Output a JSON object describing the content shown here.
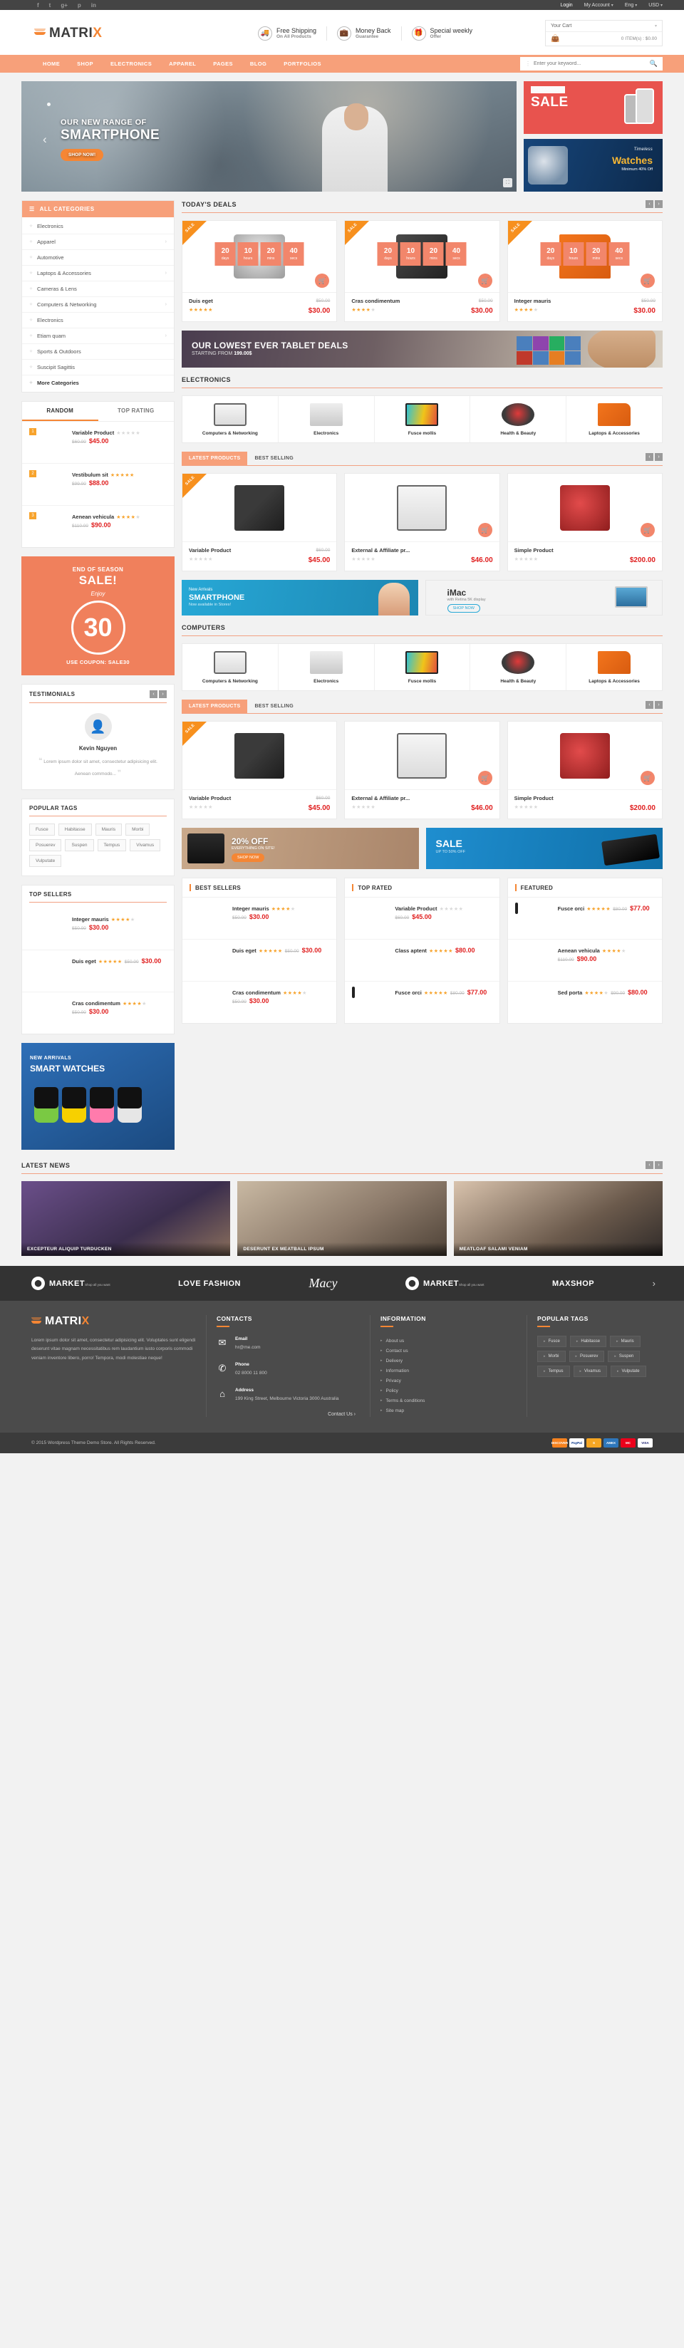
{
  "topbar": {
    "social": [
      "f",
      "t",
      "g+",
      "p",
      "in"
    ],
    "links": [
      "Login",
      "My Account",
      "Eng",
      "USD"
    ]
  },
  "header": {
    "logo": {
      "text_main": "MATRI",
      "text_accent": "X"
    },
    "features": [
      {
        "icon": "truck-icon",
        "title": "Free Shipping",
        "sub": "On All Products"
      },
      {
        "icon": "briefcase-icon",
        "title": "Money Back",
        "sub": "Guarantee"
      },
      {
        "icon": "gift-icon",
        "title": "Special weekly",
        "sub": "Offer"
      }
    ],
    "cart": {
      "label": "Your Cart",
      "summary": "0 ITEM(s) : $0.00"
    }
  },
  "nav": {
    "items": [
      "HOME",
      "SHOP",
      "ELECTRONICS",
      "APPAREL",
      "PAGES",
      "BLOG",
      "PORTFOLIOS"
    ],
    "search_placeholder": "Enter your keyword..."
  },
  "hero": {
    "line1": "OUR NEW RANGE OF",
    "line2": "SMARTPHONE",
    "button": "SHOP NOW!"
  },
  "promos": {
    "sale": {
      "tag": "CLEARANCE",
      "title": "SALE"
    },
    "watch": {
      "l1": "Timeless",
      "l2": "Watches",
      "l3": "Minimum 40% Off"
    }
  },
  "sidebar": {
    "categories_title": "ALL CATEGORIES",
    "categories": [
      {
        "label": "Electronics",
        "has_arrow": false
      },
      {
        "label": "Apparel",
        "has_arrow": true
      },
      {
        "label": "Automotive",
        "has_arrow": false
      },
      {
        "label": "Laptops & Accessories",
        "has_arrow": true
      },
      {
        "label": "Cameras & Lens",
        "has_arrow": false
      },
      {
        "label": "Computers & Networking",
        "has_arrow": true
      },
      {
        "label": "Electronics",
        "has_arrow": false
      },
      {
        "label": "Etiam quam",
        "has_arrow": true
      },
      {
        "label": "Sports & Outdoors",
        "has_arrow": false
      },
      {
        "label": "Suscipit Sagittis",
        "has_arrow": false
      },
      {
        "label": "More Categories",
        "has_arrow": false
      }
    ],
    "tabs": [
      "RANDOM",
      "TOP RATING"
    ],
    "random_products": [
      {
        "rank": "1",
        "name": "Variable Product",
        "stars": 0,
        "old": "$60.00",
        "new": "$45.00",
        "img": "pi-phone"
      },
      {
        "rank": "2",
        "name": "Vestibulum sit",
        "stars": 5,
        "old": "$99.00",
        "new": "$88.00",
        "img": "pi-micro"
      },
      {
        "rank": "3",
        "name": "Aenean vehicula",
        "stars": 4,
        "old": "$110.00",
        "new": "$90.00",
        "img": "pi-wash"
      }
    ],
    "season": {
      "l1": "END OF SEASON",
      "l2": "SALE!",
      "l3": "Enjoy",
      "number": "30",
      "l4": "USE COUPON: SALE30"
    },
    "testimonials_title": "TESTIMONIALS",
    "testimonial": {
      "name": "Kevin Nguyen",
      "text": "Lorem ipsum dolor sit amet, consectetur adipisicing elit. Aenean commodo..."
    },
    "tags_title": "POPULAR TAGS",
    "tags": [
      "Fusce",
      "Habitasse",
      "Mauris",
      "Morbi",
      "Posuerev",
      "Suspen",
      "Tempus",
      "Vivamus",
      "Vulputate"
    ],
    "top_sellers_title": "TOP SELLERS",
    "top_sellers": [
      {
        "name": "Integer mauris",
        "stars": 4,
        "old": "$50.00",
        "new": "$30.00",
        "img": "pi-laptop"
      },
      {
        "name": "Duis eget",
        "stars": 5,
        "old": "$50.00",
        "new": "$30.00",
        "img": "pi-watch"
      },
      {
        "name": "Cras condimentum",
        "stars": 4,
        "old": "$50.00",
        "new": "$30.00",
        "img": "pi-cam"
      }
    ],
    "watch_banner": {
      "l1": "NEW ARRIVALS",
      "l2": "SMART WATCHES"
    }
  },
  "deals": {
    "title": "TODAY'S DEALS",
    "ribbon": "SALE",
    "countdown": [
      {
        "value": "20",
        "unit": "days"
      },
      {
        "value": "10",
        "unit": "hours"
      },
      {
        "value": "20",
        "unit": "mins"
      },
      {
        "value": "40",
        "unit": "secs"
      }
    ],
    "items": [
      {
        "name": "Duis eget",
        "stars": 5,
        "old": "$50.00",
        "new": "$30.00",
        "img": "pi-watch"
      },
      {
        "name": "Cras condimentum",
        "stars": 4,
        "old": "$50.00",
        "new": "$30.00",
        "img": "pi-cam"
      },
      {
        "name": "Integer mauris",
        "stars": 4,
        "old": "$50.00",
        "new": "$30.00",
        "img": "pi-laptop"
      }
    ]
  },
  "tablet_banner": {
    "title": "OUR LOWEST EVER TABLET DEALS",
    "sub": "STARTING FROM ",
    "price": "199.00$"
  },
  "electronics": {
    "title": "ELECTRONICS",
    "categories": [
      {
        "label": "Computers & Networking",
        "img": "pi-ipad"
      },
      {
        "label": "Electronics",
        "img": "pi-wash"
      },
      {
        "label": "Fusce mollis",
        "img": "pi-tv"
      },
      {
        "label": "Health & Beauty",
        "img": "pi-head"
      },
      {
        "label": "Laptops & Accessories",
        "img": "pi-laptop"
      }
    ],
    "tabs": [
      "LATEST PRODUCTS",
      "BEST SELLING"
    ],
    "products": [
      {
        "name": "Variable Product",
        "stars": 0,
        "old": "$60.00",
        "new": "$45.00",
        "img": "pi-phone",
        "ribbon": "SALE"
      },
      {
        "name": "External & Affiliate pr...",
        "stars": 0,
        "old": "",
        "new": "$46.00",
        "img": "pi-ipad",
        "ribbon": ""
      },
      {
        "name": "Simple Product",
        "stars": 0,
        "old": "",
        "new": "$200.00",
        "img": "pi-redcam",
        "ribbon": ""
      }
    ]
  },
  "mid_banners": {
    "smartphone": {
      "l1": "New Arrivals",
      "l2": "SMARTPHONE",
      "l3": "Now available in Stores!"
    },
    "imac": {
      "l1": "iMac",
      "l2": "with Retina 5K display",
      "btn": "SHOP NOW"
    }
  },
  "computers": {
    "title": "COMPUTERS",
    "categories": [
      {
        "label": "Computers & Networking",
        "img": "pi-ipad"
      },
      {
        "label": "Electronics",
        "img": "pi-wash"
      },
      {
        "label": "Fusce mollis",
        "img": "pi-tv"
      },
      {
        "label": "Health & Beauty",
        "img": "pi-head"
      },
      {
        "label": "Laptops & Accessories",
        "img": "pi-laptop"
      }
    ],
    "tabs": [
      "LATEST PRODUCTS",
      "BEST SELLING"
    ],
    "products": [
      {
        "name": "Variable Product",
        "stars": 0,
        "old": "$60.00",
        "new": "$45.00",
        "img": "pi-phone",
        "ribbon": "SALE"
      },
      {
        "name": "External & Affiliate pr...",
        "stars": 0,
        "old": "",
        "new": "$46.00",
        "img": "pi-ipad",
        "ribbon": ""
      },
      {
        "name": "Simple Product",
        "stars": 0,
        "old": "",
        "new": "$200.00",
        "img": "pi-redcam",
        "ribbon": ""
      }
    ]
  },
  "bottom_banners": {
    "speaker": {
      "l1": "20% OFF",
      "l2": "EVERYTHING ON SITE!",
      "btn": "SHOP NOW"
    },
    "sale": {
      "l1": "SALE",
      "l2": "UP TO 50% OFF"
    }
  },
  "widgets": [
    {
      "title": "BEST SELLERS",
      "items": [
        {
          "name": "Integer mauris",
          "stars": 4,
          "old": "$50.00",
          "new": "$30.00",
          "img": "pi-laptop"
        },
        {
          "name": "Duis eget",
          "stars": 5,
          "old": "$50.00",
          "new": "$30.00",
          "img": "pi-watch"
        },
        {
          "name": "Cras condimentum",
          "stars": 4,
          "old": "$50.00",
          "new": "$30.00",
          "img": "pi-cam"
        }
      ]
    },
    {
      "title": "TOP RATED",
      "items": [
        {
          "name": "Variable Product",
          "stars": 0,
          "old": "$60.00",
          "new": "$45.00",
          "img": "pi-phone"
        },
        {
          "name": "Class aptent",
          "stars": 5,
          "old": "",
          "new": "$80.00",
          "img": "pi-lapt2"
        },
        {
          "name": "Fusce orci",
          "stars": 5,
          "old": "$80.00",
          "new": "$77.00",
          "img": "pi-tv"
        }
      ]
    },
    {
      "title": "FEATURED",
      "items": [
        {
          "name": "Fusce orci",
          "stars": 5,
          "old": "$80.00",
          "new": "$77.00",
          "img": "pi-tv"
        },
        {
          "name": "Aenean vehicula",
          "stars": 4,
          "old": "$110.00",
          "new": "$90.00",
          "img": "pi-wash"
        },
        {
          "name": "Sed porta",
          "stars": 4,
          "old": "$90.00",
          "new": "$80.00",
          "img": "pi-print"
        }
      ]
    }
  ],
  "news": {
    "title": "LATEST NEWS",
    "items": [
      {
        "caption": "EXCEPTEUR ALIQUIP TURDUCKEN",
        "img": "n1i"
      },
      {
        "caption": "DESERUNT EX MEATBALL IPSUM",
        "img": "n2i"
      },
      {
        "caption": "MEATLOAF SALAMI VENIAM",
        "img": "n3i"
      }
    ]
  },
  "brands": [
    {
      "type": "market",
      "mark": "1",
      "name": "MARKET",
      "sub": "Shop all you want"
    },
    {
      "type": "plain",
      "name": "LOVE FASHION"
    },
    {
      "type": "script",
      "name": "Macy"
    },
    {
      "type": "market",
      "mark": "1",
      "name": "MARKET",
      "sub": "Shop all you want"
    },
    {
      "type": "plain",
      "name": "MAXSHOP"
    }
  ],
  "footer": {
    "logo": {
      "text_main": "MATRI",
      "text_accent": "X"
    },
    "description": "Lorem ipsum dolor sit amet, consectetur adipisicing elit. Voluptates sunt eligendi deserunt vitae magnam necessitatibus rem laudantium iusto corporis commodi veniam inventore libero, porro! Tempora, modi molestiae neque!",
    "contacts_title": "CONTACTS",
    "contacts": [
      {
        "icon": "mail-icon",
        "label": "Email",
        "value": "hr@me.com"
      },
      {
        "icon": "phone-icon",
        "label": "Phone",
        "value": "02 8000 11 800"
      },
      {
        "icon": "home-icon",
        "label": "Address",
        "value": "199 King Street, Melbourne Victoria 3000 Australia"
      }
    ],
    "contact_link": "Contact Us ›",
    "information_title": "INFORMATION",
    "information": [
      "About us",
      "Contact us",
      "Delivery",
      "Information",
      "Privacy",
      "Policy",
      "Terms & conditions",
      "Site map"
    ],
    "tags_title": "POPULAR TAGS",
    "tags": [
      "Fusce",
      "Habitasse",
      "Mauris",
      "Morbi",
      "Posuerev",
      "Suspen",
      "Tempus",
      "Vivamus",
      "Vulputate"
    ],
    "copyright": "© 2015 Wordpress Theme Demo Store. All Rights Reserved.",
    "payments": [
      "DISCOVER",
      "PayPal",
      "S",
      "AMEX",
      "MC",
      "VISA"
    ]
  },
  "colors": {
    "accent": "#f58634",
    "nav": "#f7a07a",
    "price": "#e02020",
    "star": "#f7a32c"
  }
}
